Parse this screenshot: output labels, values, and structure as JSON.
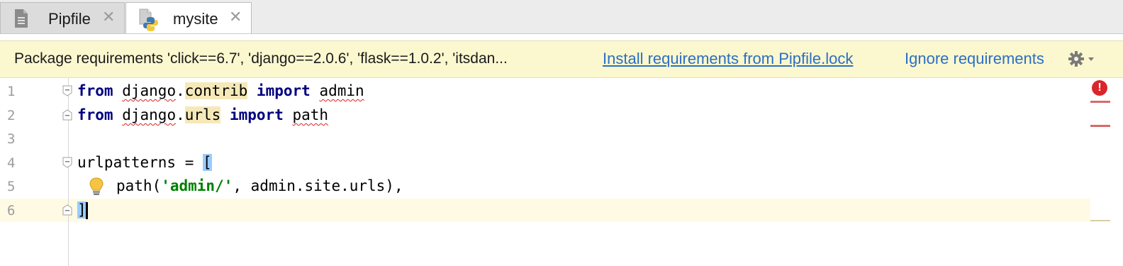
{
  "tabs": [
    {
      "label": "Pipfile",
      "icon": "document-icon",
      "active": false
    },
    {
      "label": "mysite",
      "icon": "python-file-icon",
      "active": true
    }
  ],
  "close_glyph": "✕",
  "banner": {
    "message": "Package requirements 'click==6.7', 'django==2.0.6', 'flask==1.0.2', 'itsdan...",
    "install_link": "Install requirements from Pipfile.lock",
    "ignore_link": "Ignore requirements",
    "gear_icon": "gear-icon"
  },
  "editor": {
    "line_numbers": [
      "1",
      "2",
      "3",
      "4",
      "5",
      "6"
    ],
    "lines": {
      "l1": {
        "kw1": "from",
        "mod": "django",
        "dot": ".",
        "sub": "contrib",
        "kw2": "import",
        "name": "admin"
      },
      "l2": {
        "kw1": "from",
        "mod": "django",
        "dot": ".",
        "sub": "urls",
        "kw2": "import",
        "name": "path"
      },
      "l4": {
        "var": "urlpatterns",
        "op": " = ",
        "bracket": "["
      },
      "l5": {
        "pre": "path(",
        "str": "'admin/'",
        "post": ", admin.site.urls),"
      },
      "l6": {
        "bracket": "]"
      }
    },
    "current_line": 6,
    "error_marker": "!",
    "colors": {
      "keyword": "#000080",
      "string": "#008000",
      "error": "#d9262a",
      "link": "#2b6fc4",
      "banner_bg": "#fbf7cf"
    }
  }
}
